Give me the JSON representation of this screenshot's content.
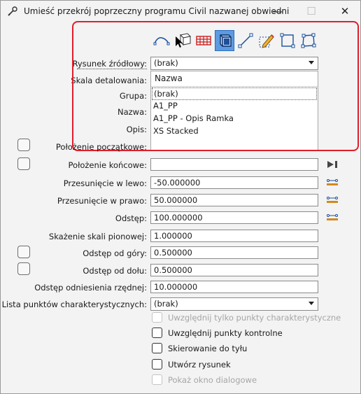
{
  "window": {
    "title": "Umieść przekrój poprzeczny programu Civil nazwanej obwiedni",
    "minimize": "—",
    "maximize": "☐",
    "close": "✕"
  },
  "toolbar": {
    "buttons": [
      "spline-icon",
      "cursor-cube-icon",
      "grid-icon",
      "box-view-icon",
      "line-icon",
      "pencil-icon",
      "square-icon",
      "quad-icon"
    ]
  },
  "form": {
    "source_drawing": {
      "label": "Rysunek źródłowy:",
      "value": "(brak)"
    },
    "detail_scale": {
      "label": "Skala detalowania:"
    },
    "group": {
      "label": "Grupa:"
    },
    "name": {
      "label": "Nazwa:"
    },
    "description": {
      "label": "Opis:"
    },
    "start_position": {
      "label": "Położenie początkowe:"
    },
    "end_position": {
      "label": "Położenie końcowe:",
      "value": ""
    },
    "offset_left": {
      "label": "Przesunięcie w lewo:",
      "value": "-50.000000"
    },
    "offset_right": {
      "label": "Przesunięcie w prawo:",
      "value": "50.000000"
    },
    "spacing": {
      "label": "Odstęp:",
      "value": "100.000000"
    },
    "vertical_scale": {
      "label": "Skażenie skali pionowej:",
      "value": "1.000000"
    },
    "top_spacing": {
      "label": "Odstęp od góry:",
      "value": "0.500000"
    },
    "bottom_spacing": {
      "label": "Odstęp od dołu:",
      "value": "0.500000"
    },
    "elevation_ref_spacing": {
      "label": "Odstęp odniesienia rzędnej:",
      "value": "10.000000"
    },
    "feature_points_list": {
      "label": "Lista punktów charakterystycznych:",
      "value": "(brak)"
    }
  },
  "dropdown": {
    "header": "Nazwa",
    "items": [
      "(brak)",
      "A1_PP",
      "A1_PP - Opis Ramka",
      "XS Stacked"
    ],
    "selected_index": 0
  },
  "checkboxes": [
    {
      "label": "Uwzględnij tylko punkty charakterystyczne",
      "checked": false,
      "enabled": false
    },
    {
      "label": "Uwzględnij punkty kontrolne",
      "checked": false,
      "enabled": true
    },
    {
      "label": "Skierowanie do tyłu",
      "checked": false,
      "enabled": true
    },
    {
      "label": "Utwórz rysunek",
      "checked": false,
      "enabled": true
    },
    {
      "label": "Pokaż okno dialogowe",
      "checked": false,
      "enabled": false
    }
  ],
  "colors": {
    "highlight_frame": "#e01e2a",
    "toolbar_active": "#5d9be0",
    "range_icon": "#d08a1e"
  }
}
